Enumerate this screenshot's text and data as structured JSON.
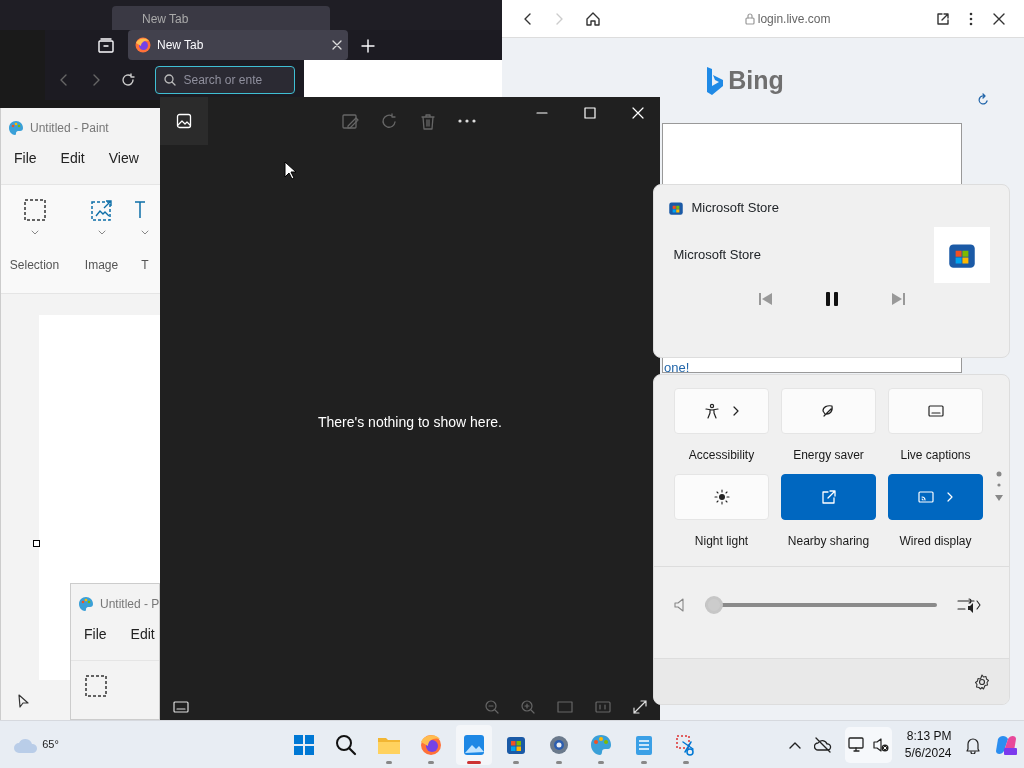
{
  "firefox_back": {
    "tab_title": "New Tab"
  },
  "firefox": {
    "tab_title": "New Tab",
    "search_placeholder": "Search or ente"
  },
  "edge": {
    "address": "login.live.com",
    "forward_disabled": true,
    "brand": "Bing",
    "link_text": "one!"
  },
  "paint": {
    "title": "Untitled - Paint",
    "menu": [
      "File",
      "Edit",
      "View"
    ],
    "tools": [
      {
        "label": "Selection"
      },
      {
        "label": "Image"
      },
      {
        "label": "T"
      }
    ]
  },
  "paint_second": {
    "title": "Untitled - P",
    "menu": [
      "File",
      "Edit"
    ]
  },
  "photos": {
    "message": "There's nothing to show here."
  },
  "media": {
    "app": "Microsoft Store",
    "title": "Microsoft Store",
    "playing": true
  },
  "quick_settings": {
    "tiles": [
      {
        "label": "Accessibility",
        "on": false,
        "chevron": true
      },
      {
        "label": "Energy saver",
        "on": false,
        "chevron": false
      },
      {
        "label": "Live captions",
        "on": false,
        "chevron": false
      },
      {
        "label": "Night light",
        "on": false,
        "chevron": false
      },
      {
        "label": "Nearby sharing",
        "on": true,
        "chevron": false
      },
      {
        "label": "Wired display",
        "on": true,
        "chevron": true
      }
    ],
    "volume": {
      "level": 0
    }
  },
  "taskbar": {
    "weather": "65°",
    "apps": [
      {
        "running": false,
        "active": false
      },
      {
        "running": false,
        "active": false
      },
      {
        "running": true,
        "active": false
      },
      {
        "running": true,
        "active": false
      },
      {
        "running": true,
        "active": true
      },
      {
        "running": true,
        "active": false
      },
      {
        "running": true,
        "active": false
      },
      {
        "running": true,
        "active": false
      },
      {
        "running": true,
        "active": false
      },
      {
        "running": true,
        "active": false
      }
    ],
    "time": "8:13 PM",
    "date": "5/6/2024"
  }
}
